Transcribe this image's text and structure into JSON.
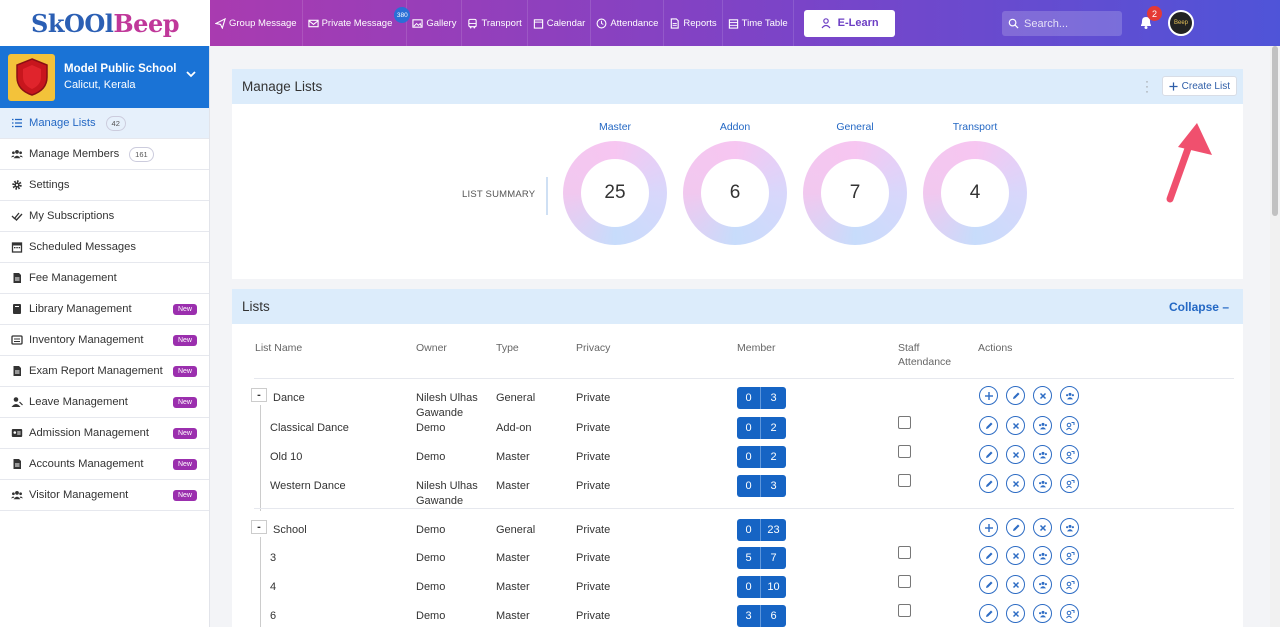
{
  "brand": {
    "logo_part1": "Sk",
    "logo_part2": "OO",
    "logo_part3": "l",
    "logo_part4": "Beep"
  },
  "topnav": {
    "items": [
      {
        "label": "Group Message",
        "icon": "send-icon"
      },
      {
        "label": "Private Message",
        "icon": "mail-icon",
        "badge": "380"
      },
      {
        "label": "Gallery",
        "icon": "image-icon"
      },
      {
        "label": "Transport",
        "icon": "bus-icon"
      },
      {
        "label": "Calendar",
        "icon": "calendar-icon"
      },
      {
        "label": "Attendance",
        "icon": "clock-icon"
      },
      {
        "label": "Reports",
        "icon": "report-icon"
      },
      {
        "label": "Time Table",
        "icon": "timetable-icon"
      }
    ],
    "elearn_label": "E-Learn",
    "search_placeholder": "Search...",
    "notification_count": "2",
    "avatar_text": "Beep"
  },
  "school": {
    "name": "Model Public School",
    "location": "Calicut, Kerala"
  },
  "sidebar": {
    "items": [
      {
        "label": "Manage Lists",
        "count": "42",
        "icon": "list-icon"
      },
      {
        "label": "Manage Members",
        "count": "161",
        "icon": "users-icon"
      },
      {
        "label": "Settings",
        "icon": "gear-icon"
      },
      {
        "label": "My Subscriptions",
        "icon": "check-double-icon"
      },
      {
        "label": "Scheduled Messages",
        "icon": "calendar-icon"
      },
      {
        "label": "Fee Management",
        "icon": "document-icon"
      },
      {
        "label": "Library Management",
        "badge": "New",
        "icon": "book-icon"
      },
      {
        "label": "Inventory Management",
        "badge": "New",
        "icon": "inventory-icon"
      },
      {
        "label": "Exam Report Management",
        "badge": "New",
        "icon": "document-icon"
      },
      {
        "label": "Leave Management",
        "badge": "New",
        "icon": "user-leave-icon"
      },
      {
        "label": "Admission Management",
        "badge": "New",
        "icon": "id-card-icon"
      },
      {
        "label": "Accounts Management",
        "badge": "New",
        "icon": "document-icon"
      },
      {
        "label": "Visitor Management",
        "badge": "New",
        "icon": "users-icon"
      }
    ]
  },
  "manage_lists": {
    "title": "Manage Lists",
    "create_button": "Create List",
    "summary_label": "LIST SUMMARY",
    "summary": [
      {
        "title": "Master",
        "value": "25"
      },
      {
        "title": "Addon",
        "value": "6"
      },
      {
        "title": "General",
        "value": "7"
      },
      {
        "title": "Transport",
        "value": "4"
      }
    ]
  },
  "lists": {
    "title": "Lists",
    "collapse_label": "Collapse –",
    "columns": {
      "list_name": "List Name",
      "owner": "Owner",
      "type": "Type",
      "privacy": "Privacy",
      "member": "Member",
      "staff_attendance_1": "Staff",
      "staff_attendance_2": "Attendance",
      "actions": "Actions"
    },
    "rows": [
      {
        "name": "Dance",
        "owner1": "Nilesh Ulhas",
        "owner2": "Gawande",
        "type": "General",
        "privacy": "Private",
        "m1": "0",
        "m2": "3"
      },
      {
        "name": "Classical Dance",
        "owner1": "Demo",
        "owner2": "",
        "type": "Add-on",
        "privacy": "Private",
        "m1": "0",
        "m2": "2"
      },
      {
        "name": "Old 10",
        "owner1": "Demo",
        "owner2": "",
        "type": "Master",
        "privacy": "Private",
        "m1": "0",
        "m2": "2"
      },
      {
        "name": "Western Dance",
        "owner1": "Nilesh Ulhas",
        "owner2": "Gawande",
        "type": "Master",
        "privacy": "Private",
        "m1": "0",
        "m2": "3"
      },
      {
        "name": "School",
        "owner1": "Demo",
        "owner2": "",
        "type": "General",
        "privacy": "Private",
        "m1": "0",
        "m2": "23"
      },
      {
        "name": "3",
        "owner1": "Demo",
        "owner2": "",
        "type": "Master",
        "privacy": "Private",
        "m1": "5",
        "m2": "7"
      },
      {
        "name": "4",
        "owner1": "Demo",
        "owner2": "",
        "type": "Master",
        "privacy": "Private",
        "m1": "0",
        "m2": "10"
      },
      {
        "name": "6",
        "owner1": "Demo",
        "owner2": "",
        "type": "Master",
        "privacy": "Private",
        "m1": "3",
        "m2": "6"
      }
    ]
  },
  "colors": {
    "accent": "#1664c4",
    "nav_start": "#a93bb0",
    "nav_end": "#4f54d8",
    "new_badge": "#9b2fae",
    "arrow": "#f0506e"
  }
}
